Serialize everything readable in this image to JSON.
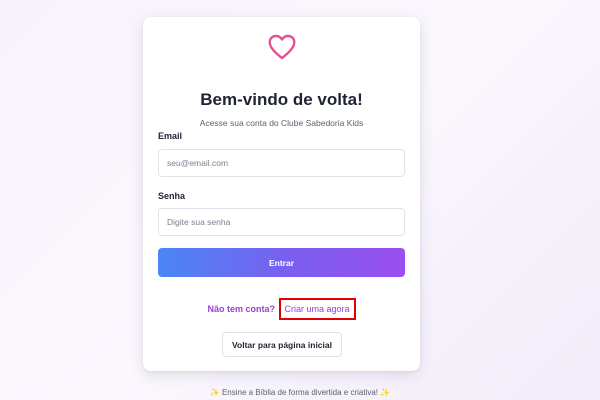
{
  "login": {
    "title": "Bem-vindo de volta!",
    "subtitle": "Acesse sua conta do Clube Sabedoria Kids",
    "email_label": "Email",
    "email_placeholder": "seu@email.com",
    "password_label": "Senha",
    "password_placeholder": "Digite sua senha",
    "submit_label": "Entrar",
    "signup_prompt": "Não tem conta?",
    "signup_link": "Criar uma agora",
    "back_label": "Voltar para página inicial"
  },
  "footer": {
    "sparkle_left": "✨",
    "tagline": "Ensine a Bíblia de forma divertida e criativa!",
    "sparkle_right": "✨"
  },
  "colors": {
    "heart": "#e64d95",
    "accent_purple": "#9a3fd8",
    "gradient_start": "#4a86f4",
    "gradient_end": "#9b4ff0",
    "highlight_box": "#e00000"
  },
  "icons": {
    "logo": "heart-icon"
  }
}
